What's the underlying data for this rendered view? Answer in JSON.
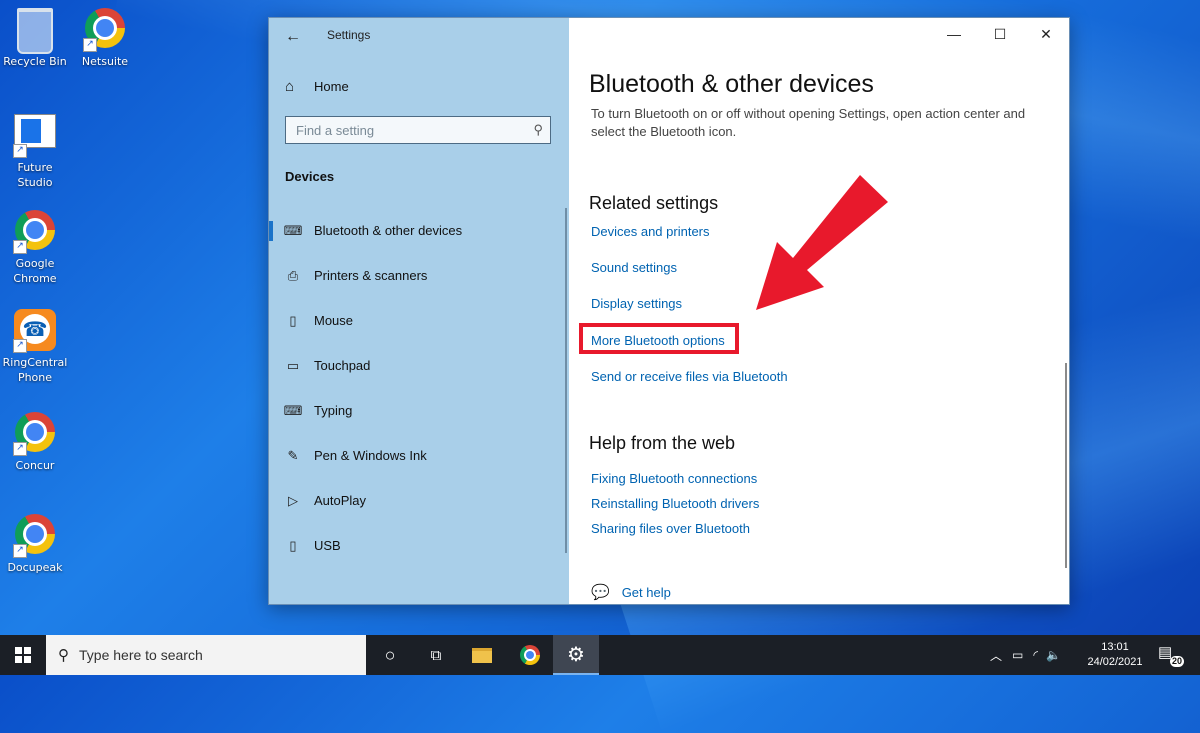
{
  "desktop": {
    "icons": [
      {
        "label": "Recycle Bin"
      },
      {
        "label": "Netsuite"
      },
      {
        "label": "Future Studio"
      },
      {
        "label": "Google Chrome"
      },
      {
        "label": "RingCentral Phone"
      },
      {
        "label": "Concur"
      },
      {
        "label": "Docupeak"
      }
    ]
  },
  "window": {
    "title": "Settings",
    "back_icon": "←",
    "controls": {
      "minimize": "—",
      "maximize": "☐",
      "close": "✕"
    }
  },
  "sidebar": {
    "home_label": "Home",
    "search_placeholder": "Find a setting",
    "section_label": "Devices",
    "items": [
      {
        "label": "Bluetooth & other devices",
        "icon": "bluetooth-devices-icon",
        "glyph": "⌨",
        "active": true
      },
      {
        "label": "Printers & scanners",
        "icon": "printer-icon",
        "glyph": "⎙"
      },
      {
        "label": "Mouse",
        "icon": "mouse-icon",
        "glyph": "▯"
      },
      {
        "label": "Touchpad",
        "icon": "touchpad-icon",
        "glyph": "▭"
      },
      {
        "label": "Typing",
        "icon": "keyboard-icon",
        "glyph": "⌨"
      },
      {
        "label": "Pen & Windows Ink",
        "icon": "pen-icon",
        "glyph": "✎"
      },
      {
        "label": "AutoPlay",
        "icon": "autoplay-icon",
        "glyph": "▷"
      },
      {
        "label": "USB",
        "icon": "usb-icon",
        "glyph": "▯"
      }
    ]
  },
  "main": {
    "title": "Bluetooth & other devices",
    "description": "To turn Bluetooth on or off without opening Settings, open action center and select the Bluetooth icon.",
    "related_heading": "Related settings",
    "related_links": [
      "Devices and printers",
      "Sound settings",
      "Display settings",
      "More Bluetooth options",
      "Send or receive files via Bluetooth"
    ],
    "highlighted_link_index": 3,
    "help_heading": "Help from the web",
    "help_links": [
      "Fixing Bluetooth connections",
      "Reinstalling Bluetooth drivers",
      "Sharing files over Bluetooth"
    ],
    "get_help_label": "Get help"
  },
  "annotation": {
    "arrow_color": "#e8192c",
    "highlight_color": "#e8192c"
  },
  "taskbar": {
    "search_placeholder": "Type here to search",
    "clock_time": "13:01",
    "clock_date": "24/02/2021",
    "notification_count": "20"
  },
  "colors": {
    "accent": "#0063b1",
    "sidebar_bg": "#a9cfe9",
    "taskbar_bg": "#1b1f26"
  }
}
